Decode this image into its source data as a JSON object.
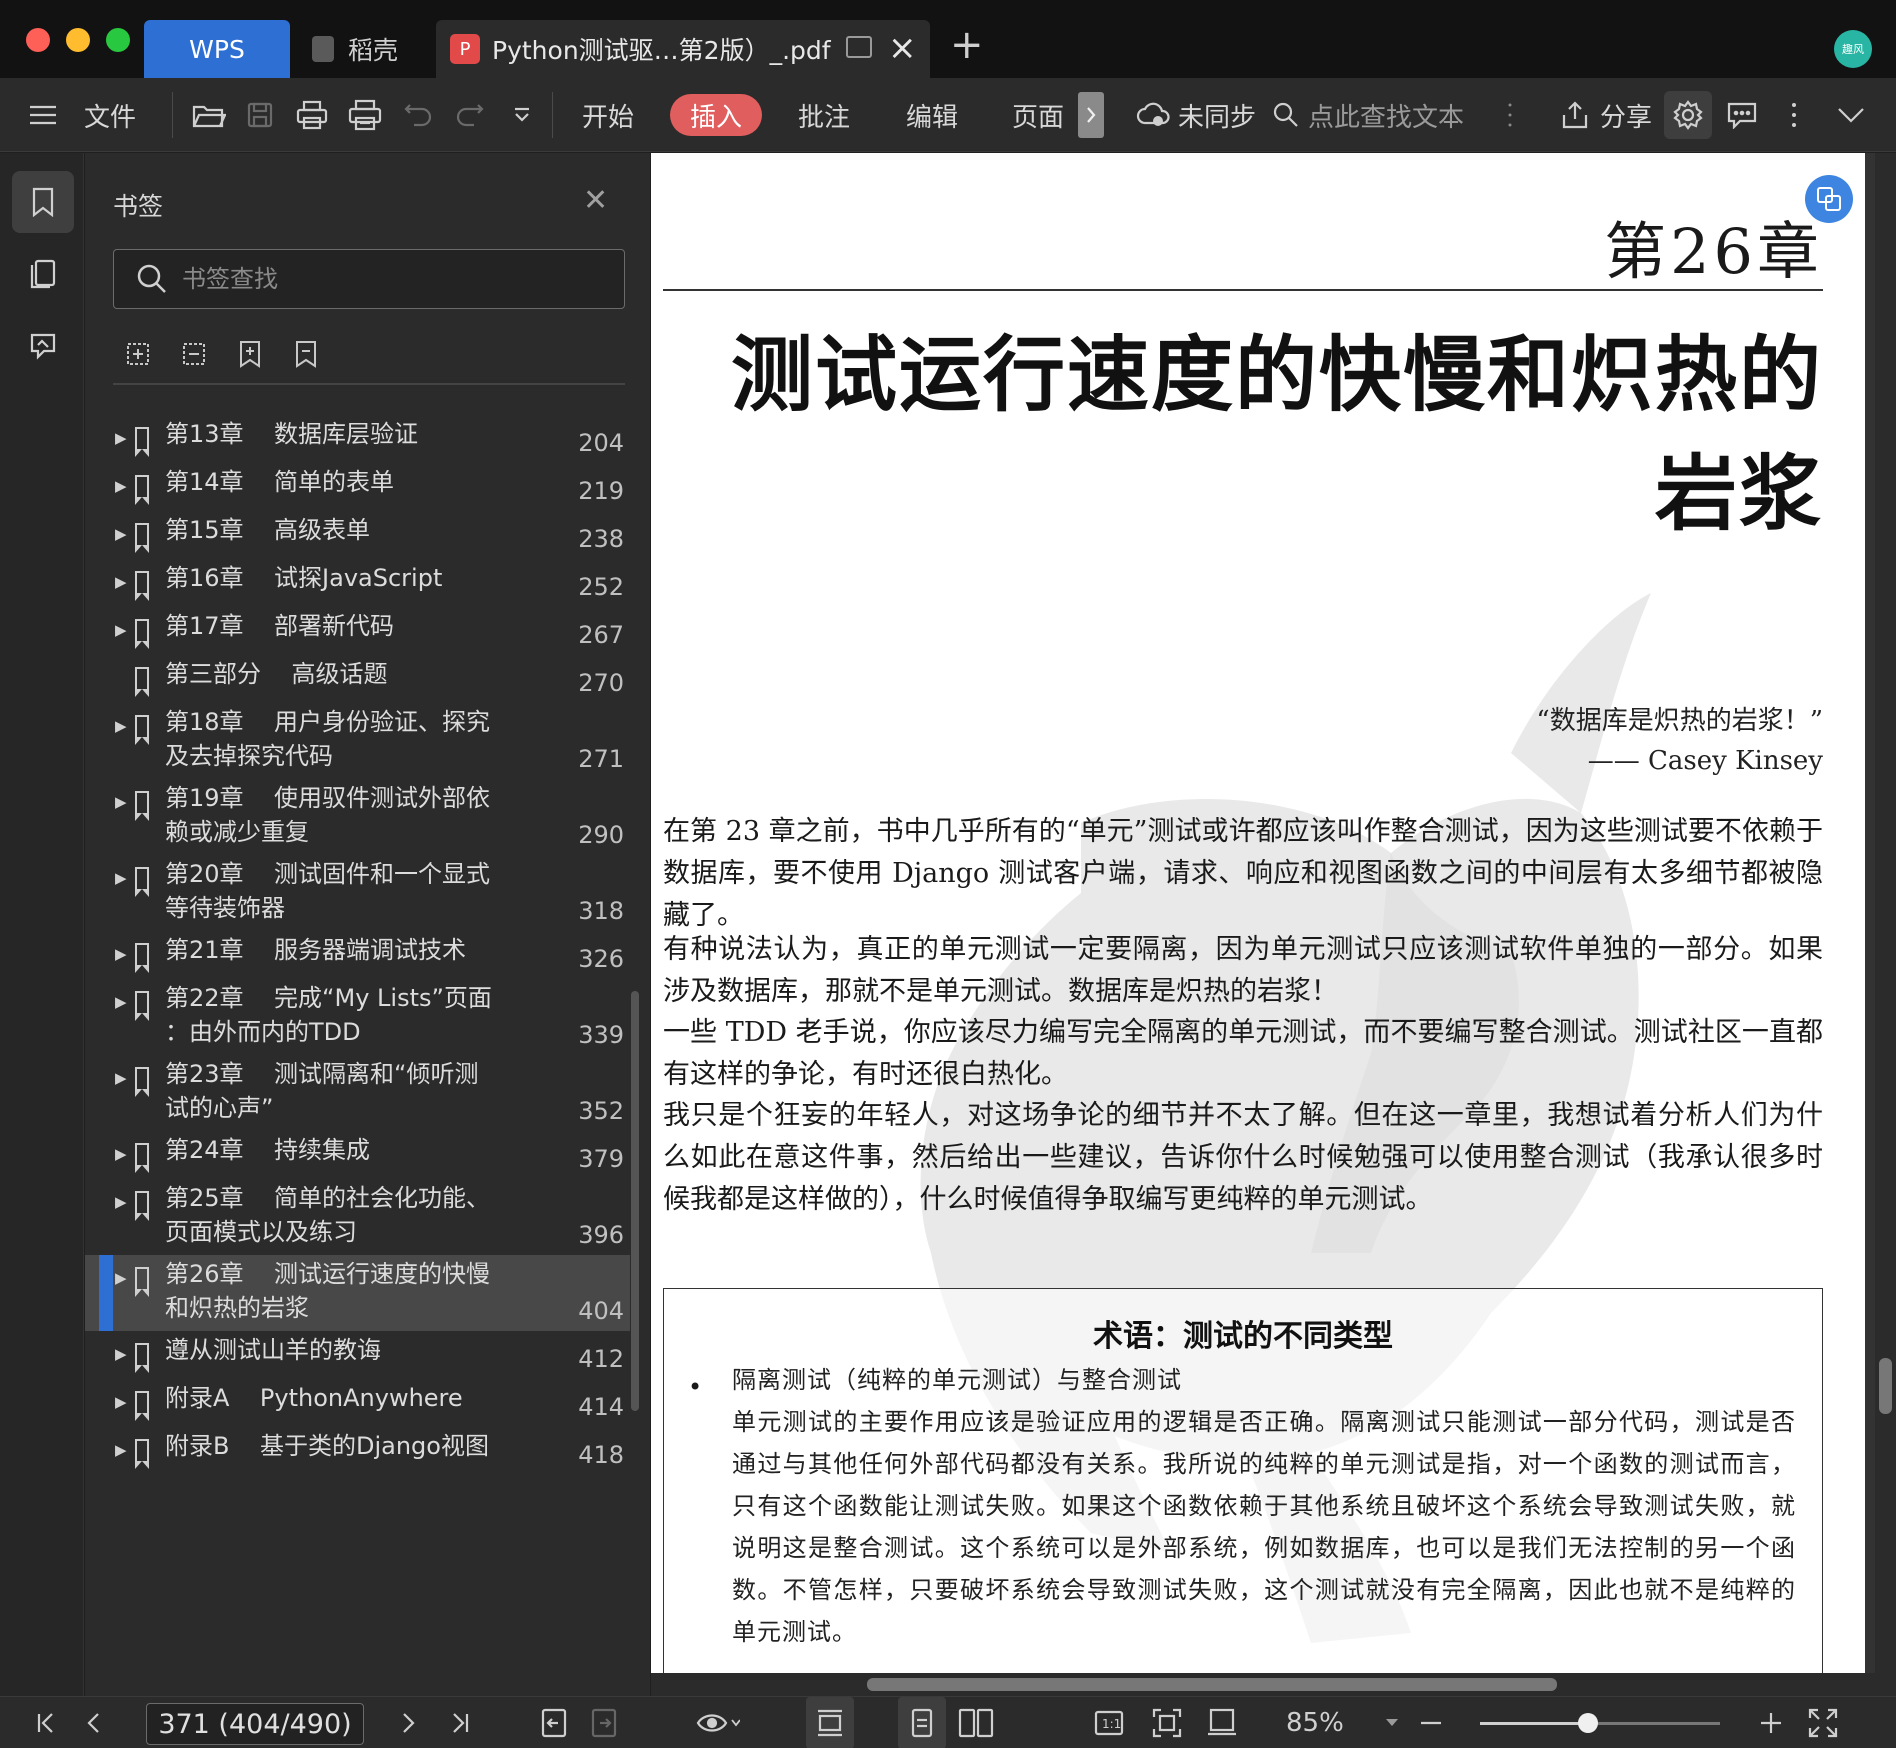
{
  "titlebar": {
    "tabs": [
      {
        "label": "WPS"
      },
      {
        "label": "稻壳"
      },
      {
        "label": "Python测试驱…第2版）_.pdf"
      }
    ],
    "avatar_text": "趣风"
  },
  "toolbar": {
    "file_label": "文件",
    "menu_tabs": [
      "开始",
      "插入",
      "批注",
      "编辑",
      "页面"
    ],
    "sync_label": "未同步",
    "search_label": "点此查找文本",
    "share_label": "分享"
  },
  "panel": {
    "title": "书签",
    "search_placeholder": "书签查找",
    "bookmarks": [
      {
        "label": "第13章    数据库层验证",
        "page": "204",
        "arrow": true
      },
      {
        "label": "第14章    简单的表单",
        "page": "219",
        "arrow": true
      },
      {
        "label": "第15章    高级表单",
        "page": "238",
        "arrow": true
      },
      {
        "label": "第16章    试探JavaScript",
        "page": "252",
        "arrow": true
      },
      {
        "label": "第17章    部署新代码",
        "page": "267",
        "arrow": true
      },
      {
        "label": "第三部分    高级话题",
        "page": "270",
        "arrow": false
      },
      {
        "label": "第18章    用户身份验证、探究\n及去掉探究代码",
        "page": "271",
        "arrow": true
      },
      {
        "label": "第19章    使用驭件测试外部依\n赖或减少重复",
        "page": "290",
        "arrow": true
      },
      {
        "label": "第20章    测试固件和一个显式\n等待装饰器",
        "page": "318",
        "arrow": true
      },
      {
        "label": "第21章    服务器端调试技术",
        "page": "326",
        "arrow": true
      },
      {
        "label": "第22章    完成“My Lists”页面\n：由外而内的TDD",
        "page": "339",
        "arrow": true
      },
      {
        "label": "第23章    测试隔离和“倾听测\n试的心声”",
        "page": "352",
        "arrow": true
      },
      {
        "label": "第24章    持续集成",
        "page": "379",
        "arrow": true
      },
      {
        "label": "第25章    简单的社会化功能、\n页面模式以及练习",
        "page": "396",
        "arrow": true
      },
      {
        "label": "第26章    测试运行速度的快慢\n和炽热的岩浆",
        "page": "404",
        "arrow": true,
        "active": true
      },
      {
        "label": "遵从测试山羊的教诲",
        "page": "412",
        "arrow": true
      },
      {
        "label": "附录A    PythonAnywhere",
        "page": "414",
        "arrow": true
      },
      {
        "label": "附录B    基于类的Django视图",
        "page": "418",
        "arrow": true
      }
    ]
  },
  "document": {
    "chapter_number": "第26章",
    "chapter_title": "测试运行速度的快慢和炽热的岩浆",
    "quote_text": "“数据库是炽热的岩浆！”",
    "quote_author": "—— Casey Kinsey",
    "paragraphs": [
      "在第 23 章之前，书中几乎所有的“单元”测试或许都应该叫作整合测试，因为这些测试要不依赖于数据库，要不使用 Django 测试客户端，请求、响应和视图函数之间的中间层有太多细节都被隐藏了。",
      "有种说法认为，真正的单元测试一定要隔离，因为单元测试只应该测试软件单独的一部分。如果涉及数据库，那就不是单元测试。数据库是炽热的岩浆！",
      "一些 TDD 老手说，你应该尽力编写完全隔离的单元测试，而不要编写整合测试。测试社区一直都有这样的争论，有时还很白热化。",
      "我只是个狂妄的年轻人，对这场争论的细节并不太了解。但在这一章里，我想试着分析人们为什么如此在意这件事，然后给出一些建议，告诉你什么时候勉强可以使用整合测试（我承认很多时候我都是这样做的），什么时候值得争取编写更纯粹的单元测试。"
    ],
    "term_box": {
      "title": "术语：测试的不同类型",
      "bullet_heading": "隔离测试（纯粹的单元测试）与整合测试",
      "bullet_body": "单元测试的主要作用应该是验证应用的逻辑是否正确。隔离测试只能测试一部分代码，测试是否通过与其他任何外部代码都没有关系。我所说的纯粹的单元测试是指，对一个函数的测试而言，只有这个函数能让测试失败。如果这个函数依赖于其他系统且破坏这个系统会导致测试失败，就说明这是整合测试。这个系统可以是外部系统，例如数据库，也可以是我们无法控制的另一个函数。不管怎样，只要破坏系统会导致测试失败，这个测试就没有完全隔离，因此也就不是纯粹的单元测试。"
    }
  },
  "statusbar": {
    "page_indicator": "371 (404/490)",
    "zoom_label": "85%",
    "zoom_level": 0.45
  }
}
